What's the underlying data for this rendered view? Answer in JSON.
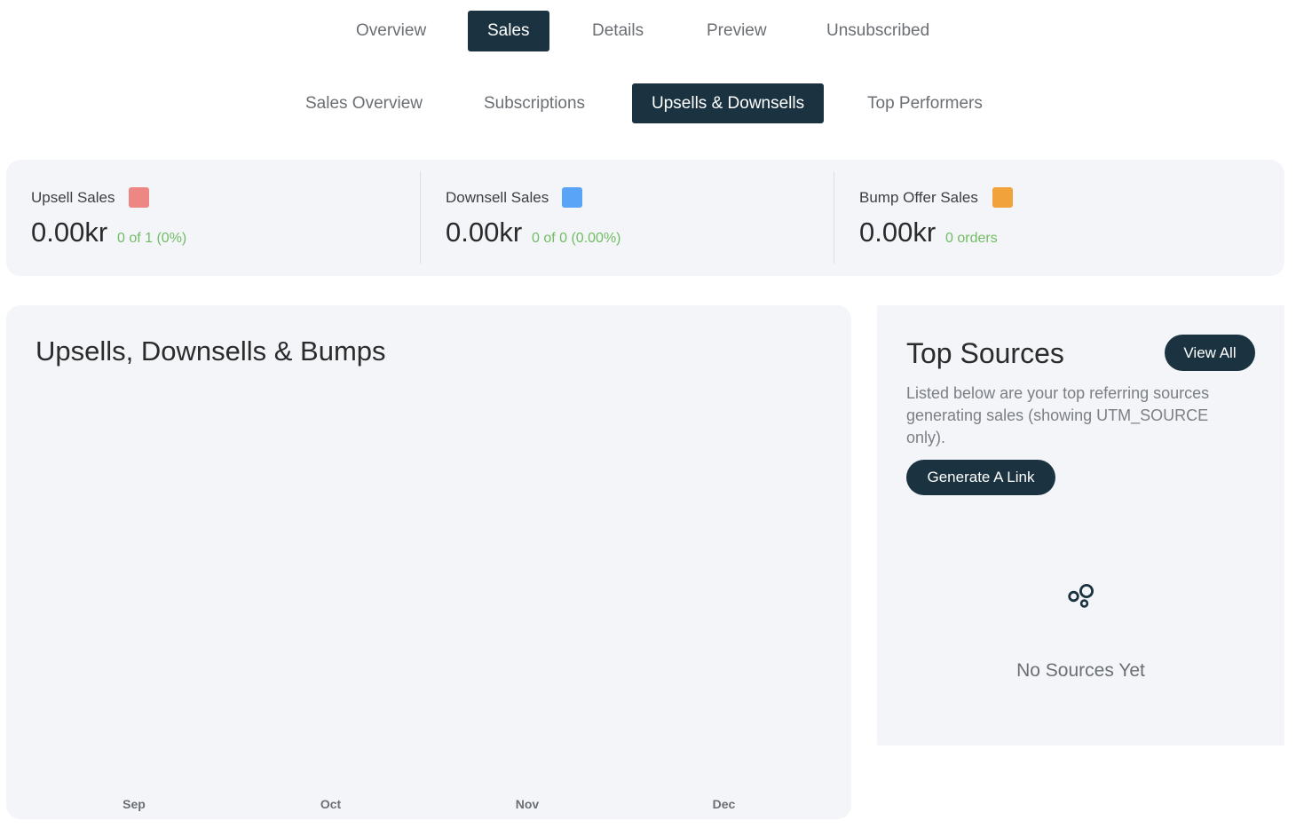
{
  "primary_tabs": [
    {
      "label": "Overview",
      "active": false
    },
    {
      "label": "Sales",
      "active": true
    },
    {
      "label": "Details",
      "active": false
    },
    {
      "label": "Preview",
      "active": false
    },
    {
      "label": "Unsubscribed",
      "active": false
    }
  ],
  "secondary_tabs": [
    {
      "label": "Sales Overview",
      "active": false
    },
    {
      "label": "Subscriptions",
      "active": false
    },
    {
      "label": "Upsells & Downsells",
      "active": true
    },
    {
      "label": "Top Performers",
      "active": false
    }
  ],
  "stats": [
    {
      "label": "Upsell Sales",
      "color": "#ec8784",
      "value": "0.00kr",
      "sub": "0 of 1 (0%)"
    },
    {
      "label": "Downsell Sales",
      "color": "#5aa4f7",
      "value": "0.00kr",
      "sub": "0 of 0 (0.00%)"
    },
    {
      "label": "Bump Offer Sales",
      "color": "#f2a23b",
      "value": "0.00kr",
      "sub": "0 orders"
    }
  ],
  "chart": {
    "title": "Upsells, Downsells & Bumps"
  },
  "chart_data": {
    "type": "bar",
    "title": "Upsells, Downsells & Bumps",
    "categories": [
      "Sep",
      "Oct",
      "Nov",
      "Dec"
    ],
    "series": [],
    "xlabel": "",
    "ylabel": "",
    "grid": false
  },
  "top_sources": {
    "title": "Top Sources",
    "view_all_label": "View All",
    "description": "Listed below are your top referring sources generating sales (showing UTM_SOURCE only).",
    "generate_label": "Generate A Link",
    "empty_icon": "bubbles-icon",
    "empty_text": "No Sources Yet"
  },
  "colors": {
    "accent": "#1b3340",
    "card_bg": "#f3f5f9",
    "positive_text": "#72bd63"
  }
}
